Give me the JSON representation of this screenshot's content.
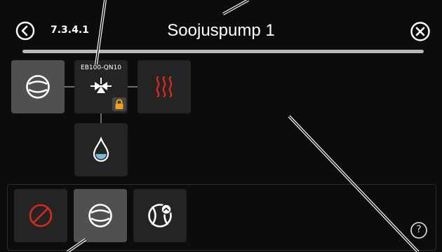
{
  "header": {
    "menu_number": "7.3.4.1",
    "title": "Soojuspump 1",
    "back_icon": "chevron-left-circle-icon",
    "close_icon": "close-circle-icon"
  },
  "diagram": {
    "compressor_icon": "compressor-icon",
    "valve_label": "EB100-QN10",
    "valve_icon": "valve-icon",
    "lock_icon": "lock-icon",
    "heating_icon": "heat-waves-icon",
    "water_icon": "water-drop-icon"
  },
  "modes": {
    "off_icon": "prohibited-icon",
    "compressor_icon": "compressor-icon",
    "forced_icon": "compressor-forced-icon",
    "help_icon": "help-circle-icon",
    "help_text": "?"
  },
  "colors": {
    "background": "#0c0c0c",
    "tile": "#242424",
    "tile_selected": "#505050",
    "heat_red": "#d42a1e",
    "lock_orange": "#f0a21c",
    "water_blue": "#78b8d8"
  }
}
